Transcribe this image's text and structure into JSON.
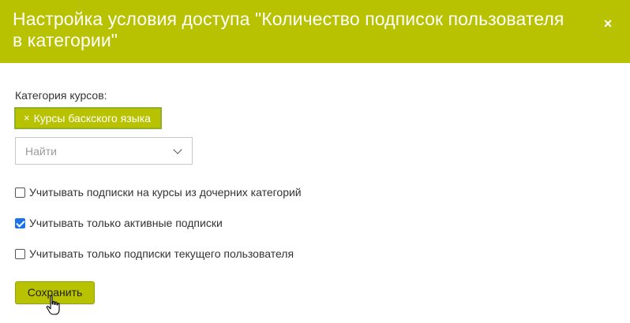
{
  "dialog": {
    "title": "Настройка условия доступа \"Количество подписок пользователя в категории\"",
    "close_icon": "×",
    "accent_color": "#b8c200"
  },
  "form": {
    "category_label": "Категория курсов:",
    "selected_tags": [
      {
        "remove_icon": "×",
        "label": "Курсы баскского языка"
      }
    ],
    "search_select": {
      "placeholder": "Найти",
      "icon": "chevron-down-icon"
    },
    "checkboxes": [
      {
        "label": "Учитывать подписки на курсы из дочерних категорий",
        "checked": false
      },
      {
        "label": "Учитывать только активные подписки",
        "checked": true
      },
      {
        "label": "Учитывать только подписки текущего пользователя",
        "checked": false
      }
    ],
    "save_label": "Сохранить"
  },
  "cursor": {
    "type": "pointer-hand-icon"
  }
}
